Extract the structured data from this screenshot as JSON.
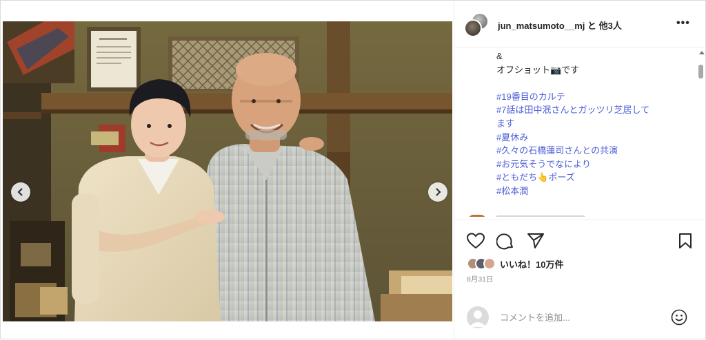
{
  "post": {
    "author": "jun_matsumoto__mj と 他3人",
    "more_label": "•••",
    "photo_alt": "",
    "carousel": {
      "count": 6,
      "active_index": 3
    }
  },
  "caption": {
    "lines": [
      {
        "text": "&",
        "tag": false
      },
      {
        "text": "オフショット📷です",
        "tag": false
      },
      {
        "text": "",
        "tag": false
      },
      {
        "text": "#19番目のカルテ",
        "tag": true
      },
      {
        "text": "#7話は田中泯さんとガッツリ芝居して",
        "tag": true
      },
      {
        "text": "ます",
        "tag": true
      },
      {
        "text": "#夏休み",
        "tag": true
      },
      {
        "text": "#久々の石橋蓮司さんとの共演",
        "tag": true
      },
      {
        "text": "#お元気そうでなにより",
        "tag": true
      },
      {
        "text": "#ともだち👆ポーズ",
        "tag": true
      },
      {
        "text": "#松本潤",
        "tag": true
      }
    ]
  },
  "actions": {
    "likes": "いいね！10万件",
    "date": "8月31日"
  },
  "comment": {
    "placeholder": "コメントを追加..."
  },
  "icons": {
    "like": "heart-icon",
    "comment": "comment-icon",
    "share": "send-icon",
    "save": "bookmark-icon",
    "emoji": "emoji-icon",
    "prev": "chevron-left-icon",
    "next": "chevron-right-icon"
  },
  "colors": {
    "hashtag": "#4c5fd7",
    "text": "#262626",
    "muted": "#8e8e8e"
  }
}
